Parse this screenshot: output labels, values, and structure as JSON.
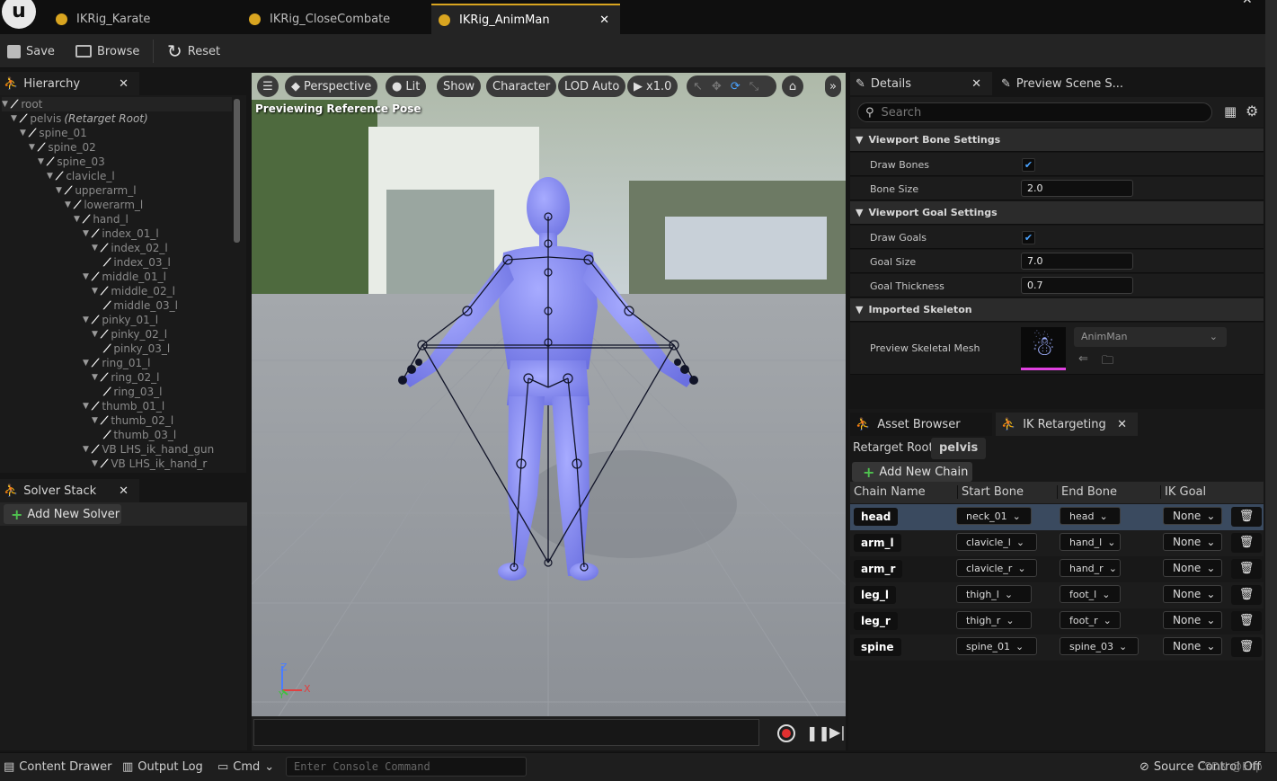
{
  "tabs": [
    {
      "label": "IKRig_Karate"
    },
    {
      "label": "IKRig_CloseCombate"
    },
    {
      "label": "IKRig_AnimMan"
    }
  ],
  "toolbar": {
    "save": "Save",
    "browse": "Browse",
    "reset": "Reset"
  },
  "hierarchy": {
    "title": "Hierarchy",
    "bones": [
      {
        "name": "root",
        "suffix": "",
        "depth": 0
      },
      {
        "name": "pelvis",
        "suffix": " (Retarget Root)",
        "depth": 1
      },
      {
        "name": "spine_01",
        "suffix": "",
        "depth": 2
      },
      {
        "name": "spine_02",
        "suffix": "",
        "depth": 3
      },
      {
        "name": "spine_03",
        "suffix": "",
        "depth": 4
      },
      {
        "name": "clavicle_l",
        "suffix": "",
        "depth": 5
      },
      {
        "name": "upperarm_l",
        "suffix": "",
        "depth": 6
      },
      {
        "name": "lowerarm_l",
        "suffix": "",
        "depth": 7
      },
      {
        "name": "hand_l",
        "suffix": "",
        "depth": 8
      },
      {
        "name": "index_01_l",
        "suffix": "",
        "depth": 9
      },
      {
        "name": "index_02_l",
        "suffix": "",
        "depth": 10
      },
      {
        "name": "index_03_l",
        "suffix": "",
        "depth": 11
      },
      {
        "name": "middle_01_l",
        "suffix": "",
        "depth": 9
      },
      {
        "name": "middle_02_l",
        "suffix": "",
        "depth": 10
      },
      {
        "name": "middle_03_l",
        "suffix": "",
        "depth": 11
      },
      {
        "name": "pinky_01_l",
        "suffix": "",
        "depth": 9
      },
      {
        "name": "pinky_02_l",
        "suffix": "",
        "depth": 10
      },
      {
        "name": "pinky_03_l",
        "suffix": "",
        "depth": 11
      },
      {
        "name": "ring_01_l",
        "suffix": "",
        "depth": 9
      },
      {
        "name": "ring_02_l",
        "suffix": "",
        "depth": 10
      },
      {
        "name": "ring_03_l",
        "suffix": "",
        "depth": 11
      },
      {
        "name": "thumb_01_l",
        "suffix": "",
        "depth": 9
      },
      {
        "name": "thumb_02_l",
        "suffix": "",
        "depth": 10
      },
      {
        "name": "thumb_03_l",
        "suffix": "",
        "depth": 11
      },
      {
        "name": "VB LHS_ik_hand_gun",
        "suffix": "",
        "depth": 9
      },
      {
        "name": "VB LHS_ik_hand_r",
        "suffix": "",
        "depth": 10
      }
    ]
  },
  "solver_stack": {
    "title": "Solver Stack",
    "add_label": "Add New Solver"
  },
  "viewport": {
    "perspective": "Perspective",
    "lit": "Lit",
    "show": "Show",
    "character": "Character",
    "lod": "LOD Auto",
    "speed": "x1.0",
    "overlay": "Previewing Reference Pose",
    "axis_z": "Z",
    "axis_y": "Y",
    "axis_x": "X"
  },
  "details": {
    "tab": "Details",
    "tab2": "Preview Scene S...",
    "search_placeholder": "Search",
    "sec_bone": "Viewport Bone Settings",
    "draw_bones": "Draw Bones",
    "draw_bones_checked": true,
    "bone_size": "Bone Size",
    "bone_size_val": "2.0",
    "sec_goal": "Viewport Goal Settings",
    "draw_goals": "Draw Goals",
    "draw_goals_checked": true,
    "goal_size": "Goal Size",
    "goal_size_val": "7.0",
    "goal_thickness": "Goal Thickness",
    "goal_thickness_val": "0.7",
    "sec_skel": "Imported Skeleton",
    "preview_mesh": "Preview Skeletal Mesh",
    "mesh_val": "AnimMan"
  },
  "retarget": {
    "tab1": "Asset Browser",
    "tab2": "IK Retargeting",
    "root_label": "Retarget Root:",
    "root_val": "pelvis",
    "add_chain": "Add New Chain",
    "headers": {
      "chain": "Chain Name",
      "start": "Start Bone",
      "end": "End Bone",
      "goal": "IK Goal"
    },
    "rows": [
      {
        "chain": "head",
        "start": "neck_01",
        "end": "head",
        "goal": "None"
      },
      {
        "chain": "arm_l",
        "start": "clavicle_l",
        "end": "hand_l",
        "goal": "None"
      },
      {
        "chain": "arm_r",
        "start": "clavicle_r",
        "end": "hand_r",
        "goal": "None"
      },
      {
        "chain": "leg_l",
        "start": "thigh_l",
        "end": "foot_l",
        "goal": "None"
      },
      {
        "chain": "leg_r",
        "start": "thigh_r",
        "end": "foot_r",
        "goal": "None"
      },
      {
        "chain": "spine",
        "start": "spine_01",
        "end": "spine_03",
        "goal": "None"
      }
    ]
  },
  "bottom": {
    "content_drawer": "Content Drawer",
    "output_log": "Output Log",
    "cmd": "Cmd",
    "console_placeholder": "Enter Console Command",
    "source_control": "Source Control Off",
    "watermark": "CSDN @Elfp"
  },
  "colors": {
    "accent": "#d9a520",
    "selected_row": "#3a4a5f",
    "checkbox": "#4aa3ff",
    "mannequin": "#7f84ef"
  }
}
